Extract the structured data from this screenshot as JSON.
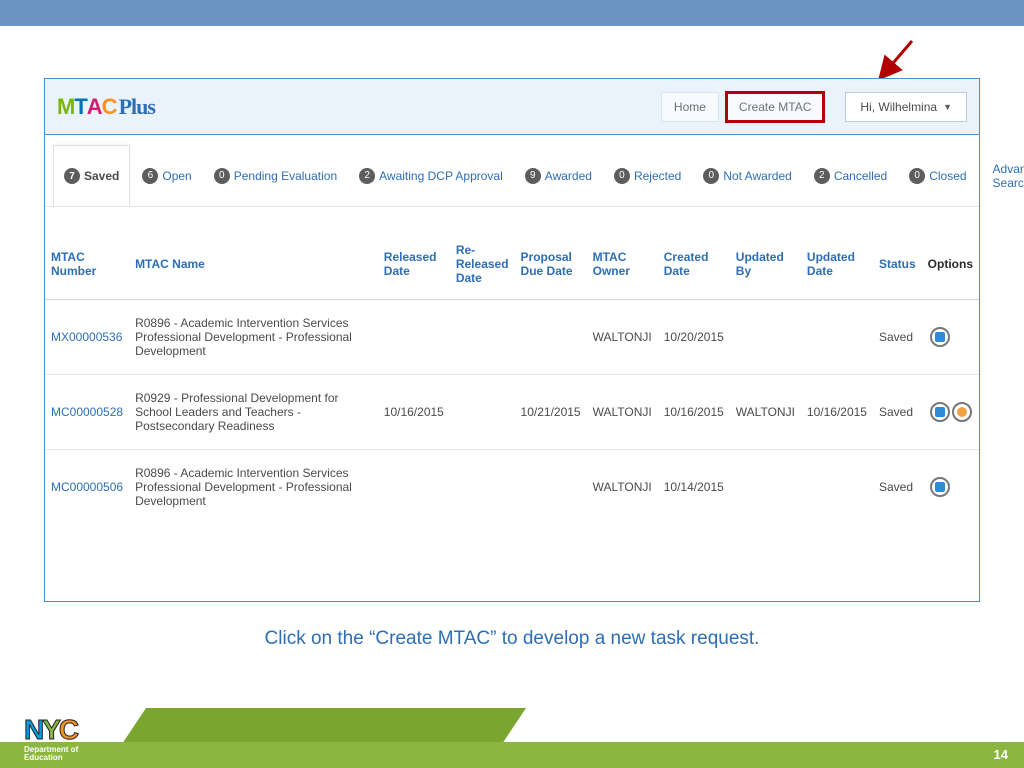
{
  "header": {
    "logo_script": "Plus",
    "home_label": "Home",
    "create_label": "Create MTAC",
    "user_label": "Hi, Wilhelmina"
  },
  "tabs": [
    {
      "count": "7",
      "label": "Saved",
      "active": true
    },
    {
      "count": "6",
      "label": "Open"
    },
    {
      "count": "0",
      "label": "Pending Evaluation"
    },
    {
      "count": "2",
      "label": "Awaiting DCP Approval"
    },
    {
      "count": "9",
      "label": "Awarded"
    },
    {
      "count": "0",
      "label": "Rejected"
    },
    {
      "count": "0",
      "label": "Not Awarded"
    },
    {
      "count": "2",
      "label": "Cancelled"
    },
    {
      "count": "0",
      "label": "Closed"
    }
  ],
  "adv_search": "Advanced Search",
  "columns": {
    "num": "MTAC Number",
    "name": "MTAC Name",
    "released": "Released Date",
    "rereleased": "Re-Released Date",
    "proposal": "Proposal Due Date",
    "owner": "MTAC Owner",
    "created": "Created Date",
    "updby": "Updated By",
    "upddate": "Updated Date",
    "status": "Status",
    "options": "Options"
  },
  "rows": [
    {
      "num": "MX00000536",
      "name": "R0896 - Academic Intervention Services Professional Development - Professional Development",
      "released": "",
      "rereleased": "",
      "proposal": "",
      "owner": "WALTONJI",
      "created": "10/20/2015",
      "updby": "",
      "upddate": "",
      "status": "Saved",
      "icons": [
        "edit"
      ]
    },
    {
      "num": "MC00000528",
      "name": "R0929 - Professional Development for School Leaders and Teachers - Postsecondary Readiness",
      "released": "10/16/2015",
      "rereleased": "",
      "proposal": "10/21/2015",
      "owner": "WALTONJI",
      "created": "10/16/2015",
      "updby": "WALTONJI",
      "upddate": "10/16/2015",
      "status": "Saved",
      "icons": [
        "edit",
        "clock"
      ]
    },
    {
      "num": "MC00000506",
      "name": "R0896 - Academic Intervention Services Professional Development - Professional Development",
      "released": "",
      "rereleased": "",
      "proposal": "",
      "owner": "WALTONJI",
      "created": "10/14/2015",
      "updby": "",
      "upddate": "",
      "status": "Saved",
      "icons": [
        "edit"
      ]
    }
  ],
  "caption": "Click on the “Create MTAC” to develop a new task request.",
  "nyc": {
    "dept": "Department of",
    "edu": "Education"
  },
  "page_num": "14"
}
